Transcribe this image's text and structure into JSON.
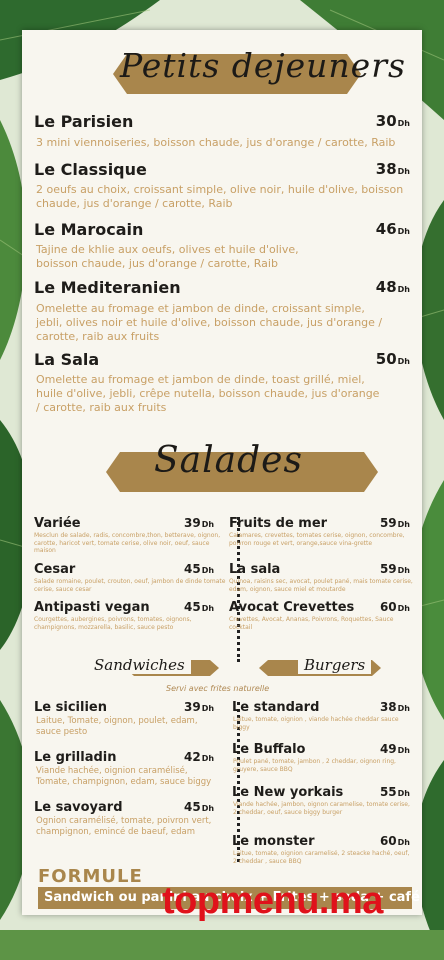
{
  "petits": {
    "title": "Petits dejeuners",
    "items": [
      {
        "name": "Le Parisien",
        "price": "30",
        "unit": "Dh",
        "desc": "3 mini viennoiseries, boisson chaude, jus d'orange / carotte, Raib"
      },
      {
        "name": "Le Classique",
        "price": "38",
        "unit": "Dh",
        "desc": "2 oeufs au choix, croissant simple, olive noir, huile d'olive, boisson chaude, jus d'orange / carotte, Raib"
      },
      {
        "name": "Le Marocain",
        "price": "46",
        "unit": "Dh",
        "desc": "Tajine de khlie aux oeufs, olives et huile d'olive, boisson chaude, jus d'orange / carotte, Raib"
      },
      {
        "name": "Le Mediteranien",
        "price": "48",
        "unit": "Dh",
        "desc": "Omelette au fromage et jambon de dinde, croissant simple, jebli, olives noir et huile d'olive, boisson chaude, jus d'orange / carotte, raib aux fruits"
      },
      {
        "name": "La Sala",
        "price": "50",
        "unit": "Dh",
        "desc": "Omelette au fromage et jambon de dinde, toast grillé, miel, huile d'olive, jebli, crêpe nutella, boisson chaude, jus d'orange / carotte, raib aux fruits"
      }
    ]
  },
  "salades": {
    "title": "Salades",
    "left": [
      {
        "name": "Variée",
        "price": "39",
        "unit": "Dh",
        "desc": "Mesclun de salade, radis, concombre,thon, betterave, oignon, carotte, haricot vert, tomate cerise, olive noir, oeuf, sauce maison"
      },
      {
        "name": "Cesar",
        "price": "45",
        "unit": "Dh",
        "desc": "Salade romaine, poulet, crouton, oeuf, jambon de dinde tomate cerise, sauce cesar"
      },
      {
        "name": "Antipasti vegan",
        "price": "45",
        "unit": "Dh",
        "desc": "Courgettes, aubergines, poivrons, tomates, oignons, champignons, mozzarella, basilic, sauce pesto"
      }
    ],
    "right": [
      {
        "name": "Fruits de mer",
        "price": "59",
        "unit": "Dh",
        "desc": "Calamares, crevettes, tomates cerise, oignon, concombre, poivron rouge et vert, orange,sauce vina-grette"
      },
      {
        "name": "La sala",
        "price": "59",
        "unit": "Dh",
        "desc": "Quinoa, raisins sec, avocat, poulet pané, mais tomate cerise, edam, oignon, sauce miel et moutarde"
      },
      {
        "name": "Avocat Crevettes",
        "price": "60",
        "unit": "Dh",
        "desc": "Crevettes, Avocat, Ananas, Poivrons, Roquettes, Sauce cocktail"
      }
    ]
  },
  "sandwiches": {
    "title": "Sandwiches",
    "note": "Servi avec frites naturelle",
    "items": [
      {
        "name": "Le sicilien",
        "price": "39",
        "unit": "Dh",
        "desc": "Laitue, Tomate, oignon, poulet, edam, sauce pesto"
      },
      {
        "name": "Le grilladin",
        "price": "42",
        "unit": "Dh",
        "desc": "Viande hachée, oignion caramélisé, Tomate, champignon, edam, sauce biggy"
      },
      {
        "name": "Le savoyard",
        "price": "45",
        "unit": "Dh",
        "desc": "Ognion caramélisé, tomate, poivron vert, champignon, emincé de baeuf, edam"
      }
    ]
  },
  "burgers": {
    "title": "Burgers",
    "items": [
      {
        "name": "Le standard",
        "price": "38",
        "unit": "Dh",
        "desc": "Laitue, tomate, oignion , viande hachée cheddar sauce biggy"
      },
      {
        "name": "Le Buffalo",
        "price": "49",
        "unit": "Dh",
        "desc": "Poulet pané, tomate, jambon , 2 cheddar, oignon ring, gruyere, sauce BBQ"
      },
      {
        "name": "Le New yorkais",
        "price": "55",
        "unit": "Dh",
        "desc": "Viande hachée, jambon, oignon caramelise, tomate cerise, 2 cheddar, oeuf, sauce biggy burger"
      },
      {
        "name": "Le monster",
        "price": "60",
        "unit": "Dh",
        "desc": "Laitue, tomate, oignion caramelisé, 2 steacke haché, oeuf, 2 cheddar , sauce BBQ"
      }
    ]
  },
  "formule": {
    "title": "FORMULE",
    "text": "Sandwich ou panini au choix + Frites + soda + café"
  },
  "watermark": "topmenu.ma",
  "colors": {
    "accent": "#a9864c",
    "desc": "#c8a066",
    "background": "#f8f6ef",
    "leaves": "#2f6b35",
    "watermark": "#e0121b"
  }
}
